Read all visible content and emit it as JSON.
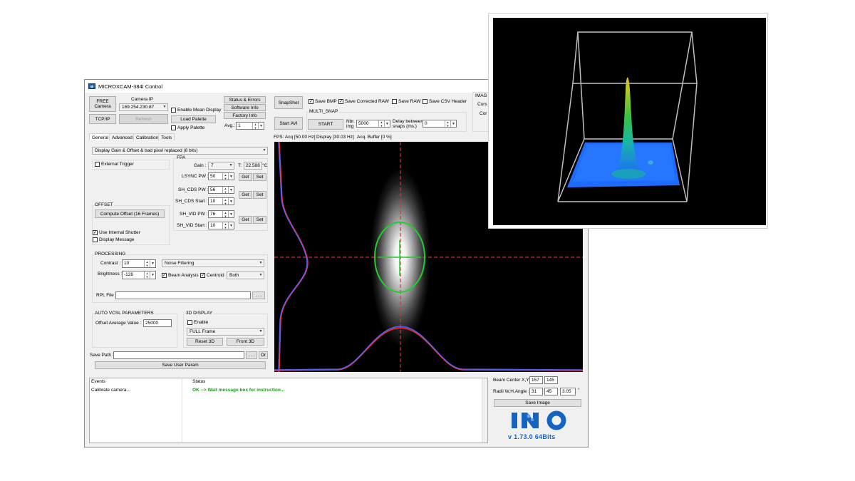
{
  "window": {
    "title": "MICROXCAM-384I Control"
  },
  "toolbar": {
    "free_camera": "FREE\nCamera",
    "camera_ip_label": "Camera IP",
    "camera_ip_value": "169.254.230.87",
    "tcpip": "TCP/IP",
    "refresh": "Refresh",
    "enable_mean_display": "Enable Mean Display",
    "load_palette": "Load Palette",
    "apply_palette": "Apply Palette",
    "status_errors": "Status & Errors",
    "software_info": "Software Info",
    "factory_info": "Factory Info",
    "avg_label": "Avg.:",
    "avg_value": "1",
    "snapshot": "SnapShot",
    "start_avi": "Start AVI",
    "save_bmp": "Save BMP",
    "save_corrected_raw": "Save Corrected RAW",
    "save_raw": "Save RAW",
    "save_csv_header": "Save CSV Header",
    "multi_snap": "MULTI_SNAP",
    "start": "START",
    "nbr_img_label": "Nbr.\nimg",
    "nbr_img_value": "5000",
    "delay_label": "Delay between\nsnaps (ms.)",
    "delay_value": "0",
    "imag_partial": "IMAG",
    "curs_partial": "Curs",
    "cor_partial": "Cor"
  },
  "tabs": [
    "General",
    "Advanced",
    "Calibration",
    "Tools"
  ],
  "status_line": {
    "fps": "FPS: Acq [50.00 Hz]",
    "display": "Display [30.03 Hz]",
    "buffer": "Acq. Buffer [0 %]"
  },
  "general": {
    "display_mode": "Display Gain & Offset & bad pixel replaced (8 bits)",
    "external_trigger": "External Trigger",
    "fpa_title": "FPA",
    "gain_label": "Gain :",
    "gain_value": "7",
    "temp_label": "T:",
    "temp_value": "22.588",
    "temp_unit": "°C",
    "lsync_label": "LSYNC PW :",
    "lsync_value": "50",
    "sh_cds_pw_label": "SH_CDS PW :",
    "sh_cds_pw_value": "56",
    "sh_cds_start_label": "SH_CDS Start :",
    "sh_cds_start_value": "10",
    "sh_vid_pw_label": "SH_VID PW :",
    "sh_vid_pw_value": "76",
    "sh_vid_start_label": "SH_VID Start :",
    "sh_vid_start_value": "10",
    "get": "Get",
    "set": "Set",
    "offset_title": "OFFSET",
    "compute_offset": "Compute Offset (16 Frames)",
    "use_internal_shutter": "Use Internal Shutter",
    "display_message": "Display Message",
    "processing_title": "PROCESSING",
    "contrast_label": "Contrast :",
    "contrast_value": "10",
    "noise_filtering": "Noise Filtering",
    "brightness_label": "Brightness :",
    "brightness_value": "-126",
    "beam_analysis": "Beam Analysis",
    "centroid": "Centroid",
    "both": "Both",
    "rpl_file_label": "RPL File :",
    "browse": ". . .",
    "auto_vcsl_title": "AUTO VCSL PARAMETERS",
    "offset_avg_label": "Offset Average Value :",
    "offset_avg_value": "25000",
    "display3d_title": "3D DISPLAY",
    "enable": "Enable",
    "full_frame": "FULL Frame",
    "reset3d": "Reset 3D",
    "front3d": "Front 3D",
    "save_path_label": "Save Path :",
    "or": "Or",
    "save_user_param": "Save User Param"
  },
  "log": {
    "col_events": "Events",
    "col_status": "Status",
    "event": "Calibrate camera...",
    "status": "OK --> Wait message box for instruction..."
  },
  "beam": {
    "center_label": "Beam Center X,Y :",
    "center_x": "157",
    "center_y": "145",
    "radii_label": "Radii W,H,Angle :",
    "radii_w": "31",
    "radii_h": "45",
    "radii_angle": "3.05",
    "deg": "°",
    "save_image": "Save Image"
  },
  "branding": {
    "logo": "INO",
    "version": "v 1.73.0  64Bits",
    "brand_blue": "#1565c0",
    "brand_light": "#6fa3dc"
  },
  "colors": {
    "crosshair": "#e03030",
    "ellipse": "#22cc33",
    "profile": "#5060ff",
    "profile_edge": "#ff3030",
    "surface": "#1e6bff"
  }
}
